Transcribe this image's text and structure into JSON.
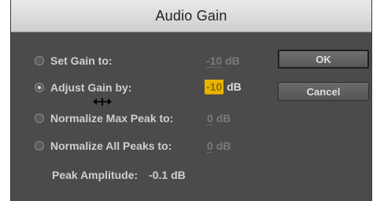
{
  "dialog": {
    "title": "Audio Gain"
  },
  "options": [
    {
      "label": "Set Gain to:",
      "value": "-10",
      "unit": "dB",
      "selected": false
    },
    {
      "label": "Adjust Gain by:",
      "value": "-10",
      "unit": "dB",
      "selected": true
    },
    {
      "label": "Normalize Max Peak to:",
      "value": "0",
      "unit": "dB",
      "selected": false
    },
    {
      "label": "Normalize All Peaks to:",
      "value": "0",
      "unit": "dB",
      "selected": false
    }
  ],
  "buttons": {
    "ok": "OK",
    "cancel": "Cancel"
  },
  "peak": {
    "label": "Peak Amplitude:",
    "value": "-0.1 dB"
  },
  "colors": {
    "dialog_bg": "#4b4b4b",
    "highlight": "#e8b400"
  },
  "cursor": {
    "icon": "horizontal-resize-cursor-icon"
  }
}
